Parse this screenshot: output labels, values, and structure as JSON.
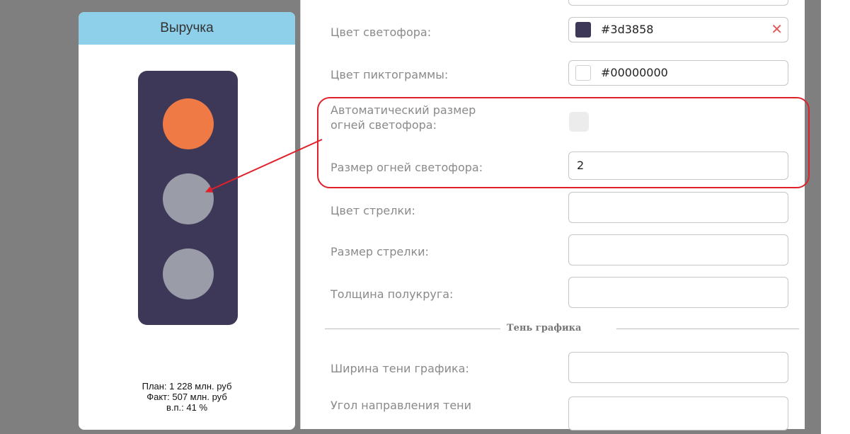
{
  "widget": {
    "title": "Выручка",
    "traffic_light_color": "#3d3858",
    "lights": [
      {
        "name": "top",
        "color": "#f07a45"
      },
      {
        "name": "middle",
        "color": "#9a9ca8"
      },
      {
        "name": "bottom",
        "color": "#9a9ca8"
      }
    ],
    "stats": {
      "plan": "План: 1 228 млн. руб",
      "fact": "Факт: 507 млн. руб",
      "percent": "в.п.: 41 %"
    }
  },
  "properties": {
    "traffic_light_color": {
      "label": "Цвет светофора:",
      "value": "#3d3858",
      "swatch": "#3d3858"
    },
    "icon_color": {
      "label": "Цвет пиктограммы:",
      "value": "#00000000",
      "swatch": "#ffffff"
    },
    "auto_light_size": {
      "label_line1": "Автоматический размер",
      "label_line2": "огней светофора:",
      "checked": false
    },
    "light_size": {
      "label": "Размер огней светофора:",
      "value": "2"
    },
    "arrow_color": {
      "label": "Цвет стрелки:",
      "value": ""
    },
    "arrow_size": {
      "label": "Размер стрелки:",
      "value": ""
    },
    "semicircle_thickness": {
      "label": "Толщина полукруга:",
      "value": ""
    },
    "shadow_section": {
      "title": "Тень графика"
    },
    "shadow_width": {
      "label": "Ширина тени графика:",
      "value": ""
    },
    "shadow_angle": {
      "label_line1": "Угол направления тени",
      "value": ""
    }
  },
  "annotation": {
    "color": "#e0202a"
  }
}
